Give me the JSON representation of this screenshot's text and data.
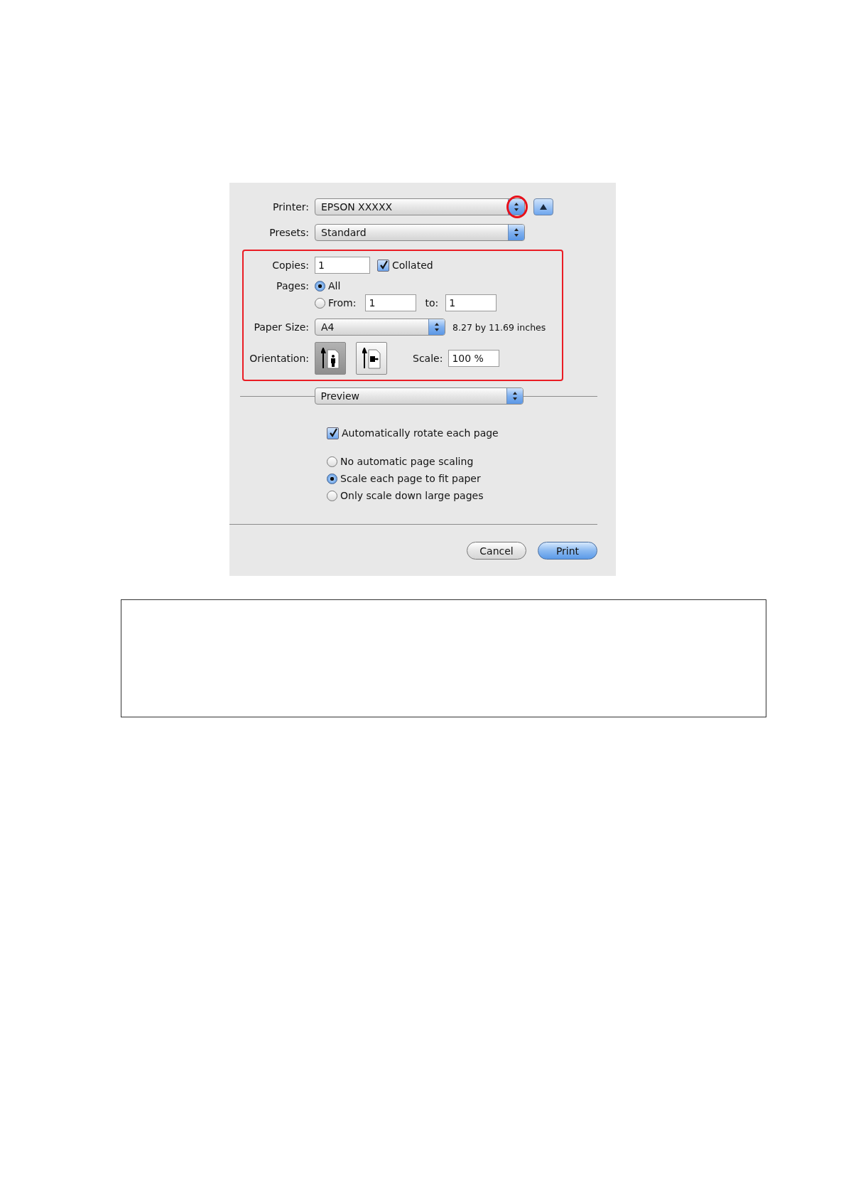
{
  "printer": {
    "label": "Printer:",
    "value": "EPSON XXXXX",
    "arrows_circled": true
  },
  "presets": {
    "label": "Presets:",
    "value": "Standard"
  },
  "settings_highlighted": true,
  "copies": {
    "label": "Copies:",
    "value": "1"
  },
  "collated": {
    "label": "Collated",
    "checked": true
  },
  "pages": {
    "label": "Pages:",
    "options": [
      {
        "label": "All",
        "selected": true
      },
      {
        "label": "From:",
        "selected": false
      }
    ],
    "from": "1",
    "to_label": "to:",
    "to": "1"
  },
  "paper_size": {
    "label": "Paper Size:",
    "value": "A4",
    "dimensions": "8.27 by 11.69 inches"
  },
  "orientation": {
    "label": "Orientation:",
    "options": [
      {
        "kind": "portrait",
        "selected": true
      },
      {
        "kind": "landscape",
        "selected": false
      }
    ]
  },
  "scale": {
    "label": "Scale:",
    "value": "100 %"
  },
  "panel": {
    "value": "Preview"
  },
  "auto_rotate": {
    "label": "Automatically rotate each page",
    "checked": true
  },
  "scaling_options": [
    {
      "label": "No automatic page scaling",
      "selected": false
    },
    {
      "label": "Scale each page to fit paper",
      "selected": true
    },
    {
      "label": "Only scale down large pages",
      "selected": false
    }
  ],
  "buttons": [
    {
      "label": "Cancel",
      "kind": "secondary"
    },
    {
      "label": "Print",
      "kind": "default"
    }
  ]
}
